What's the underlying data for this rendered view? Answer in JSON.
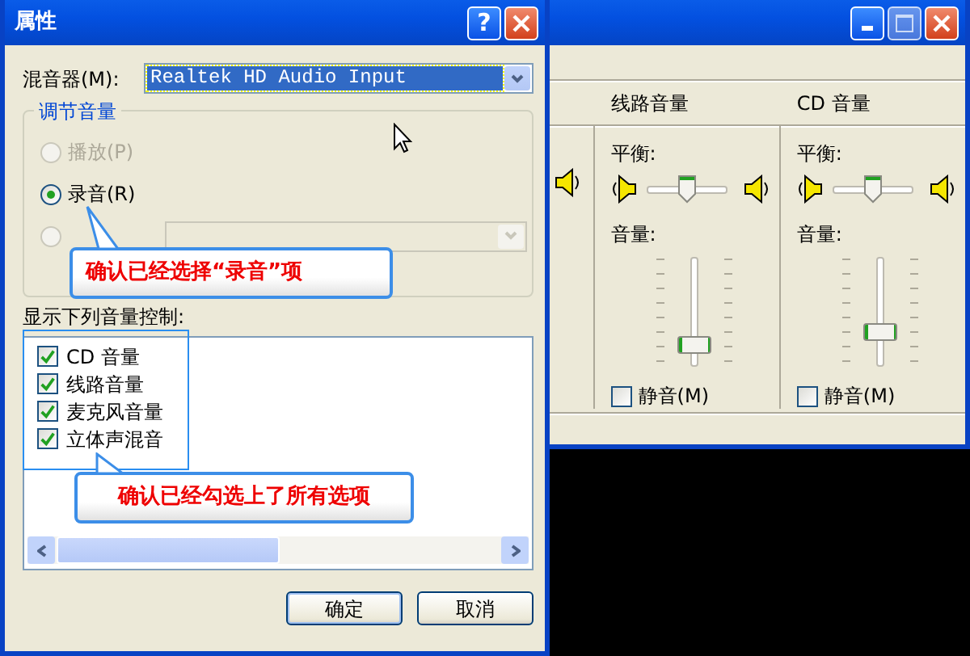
{
  "mixer_window": {
    "columns": [
      {
        "header": "线路音量",
        "balance": {
          "label": "平衡:",
          "level": 0.5
        },
        "volume": {
          "label": "音量:",
          "level": 0.2
        },
        "mute": {
          "label": "静音(M)",
          "checked": false
        }
      },
      {
        "header": "CD 音量",
        "balance": {
          "label": "平衡:",
          "level": 0.5
        },
        "volume": {
          "label": "音量:",
          "level": 0.32
        },
        "mute": {
          "label": "静音(M)",
          "checked": false
        }
      }
    ]
  },
  "dialog": {
    "title": "属性",
    "help_button": "?",
    "mixer_label": "混音器(M):",
    "mixer_value": "Realtek HD Audio Input",
    "group_title": "调节音量",
    "radios": [
      {
        "label": "播放(P)",
        "selected": false,
        "disabled": true
      },
      {
        "label": "录音(R)",
        "selected": true,
        "disabled": false
      },
      {
        "selected": false,
        "disabled": true
      }
    ],
    "device_dropdown": {
      "disabled": true
    },
    "controls_label": "显示下列音量控制:",
    "controls": [
      {
        "label": "CD 音量",
        "checked": true
      },
      {
        "label": "线路音量",
        "checked": true
      },
      {
        "label": "麦克风音量",
        "checked": true
      },
      {
        "label": "立体声混音",
        "checked": true
      }
    ],
    "buttons": [
      "确定",
      "取消"
    ]
  },
  "callouts": [
    {
      "text": "确认已经选择“录音”项"
    },
    {
      "text": "确认已经勾选上了所有选项"
    }
  ]
}
